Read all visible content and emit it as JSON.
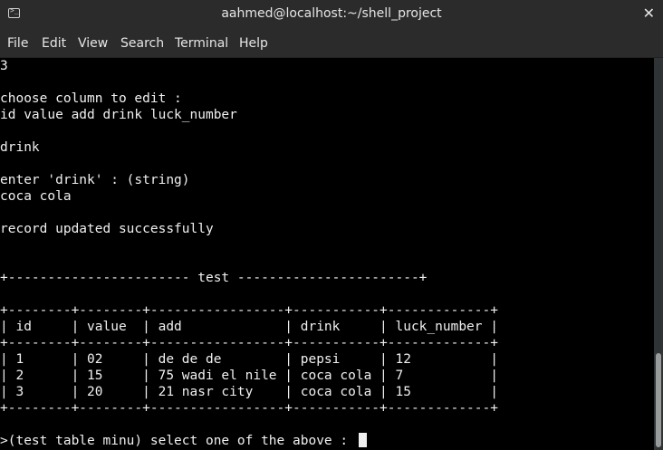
{
  "window": {
    "title": "aahmed@localhost:~/shell_project",
    "close_glyph": "✕",
    "icon": "terminal-icon"
  },
  "menu": [
    "File",
    "Edit",
    "View",
    "Search",
    "Terminal",
    "Help"
  ],
  "terminal": {
    "lines": [
      "3",
      "",
      "choose column to edit :",
      "id value add drink luck_number",
      "",
      "drink",
      "",
      "enter 'drink' : (string)",
      "coca cola",
      "",
      "record updated successfully",
      "",
      "",
      "+----------------------- test -----------------------+",
      "",
      "+--------+--------+-----------------+-----------+-------------+",
      "| id     | value  | add             | drink     | luck_number |",
      "+--------+--------+-----------------+-----------+-------------+",
      "| 1      | 02     | de de de        | pepsi     | 12          |",
      "| 2      | 15     | 75 wadi el nile | coca cola | 7           |",
      "| 3      | 20     | 21 nasr city    | coca cola | 15          |",
      "+--------+--------+-----------------+-----------+-------------+",
      ""
    ],
    "prompt": ">(test table minu) select one of the above : "
  },
  "colors": {
    "titlebar": "#2b2b2b",
    "terminal_bg": "#000000",
    "terminal_fg": "#f0f0f0",
    "scroll_thumb": "#9a9c9b"
  }
}
